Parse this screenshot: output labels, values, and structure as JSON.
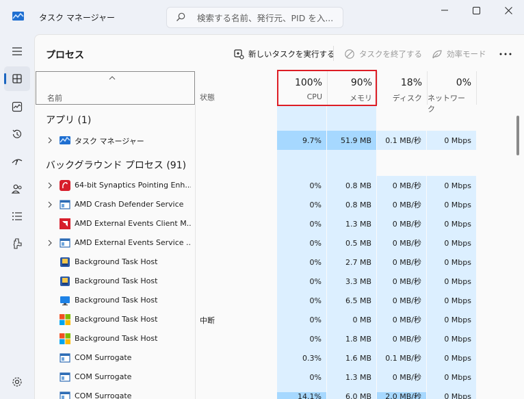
{
  "app": {
    "title": "タスク マネージャー"
  },
  "search": {
    "placeholder": "検索する名前、発行元、PID を入..."
  },
  "toolbar": {
    "page_title": "プロセス",
    "new_task": "新しいタスクを実行する",
    "end_task": "タスクを終了する",
    "efficiency": "効率モード"
  },
  "nav": [
    "hamburger-icon",
    "processes-icon",
    "performance-icon",
    "app-history-icon",
    "startup-apps-icon",
    "users-icon",
    "details-icon",
    "services-icon",
    "settings-icon"
  ],
  "columns": {
    "name": "名前",
    "status": "状態",
    "cpu": {
      "pct": "100%",
      "label": "CPU"
    },
    "memory": {
      "pct": "90%",
      "label": "メモリ"
    },
    "disk": {
      "pct": "18%",
      "label": "ディスク"
    },
    "network": {
      "pct": "0%",
      "label": "ネットワーク"
    }
  },
  "colors": {
    "highlight": "#dd1c24",
    "heat_light": "#dcefff",
    "heat_strong": "#a6d8ff",
    "accent": "#1a65c0"
  },
  "groups": {
    "apps": "アプリ (1)",
    "background": "バックグラウンド プロセス (91)"
  },
  "apps": [
    {
      "name": "タスク マネージャー",
      "status": "",
      "cpu": "9.7%",
      "memory": "51.9 MB",
      "disk": "0.1 MB/秒",
      "network": "0 Mbps",
      "expandable": true,
      "icon": "task-manager-icon"
    }
  ],
  "background": [
    {
      "name": "64-bit Synaptics Pointing Enh...",
      "status": "",
      "cpu": "0%",
      "memory": "0.8 MB",
      "disk": "0 MB/秒",
      "network": "0 Mbps",
      "expandable": true,
      "icon": "synaptics-icon"
    },
    {
      "name": "AMD Crash Defender Service",
      "status": "",
      "cpu": "0%",
      "memory": "0.8 MB",
      "disk": "0 MB/秒",
      "network": "0 Mbps",
      "expandable": true,
      "icon": "service-window-icon"
    },
    {
      "name": "AMD External Events Client M...",
      "status": "",
      "cpu": "0%",
      "memory": "1.3 MB",
      "disk": "0 MB/秒",
      "network": "0 Mbps",
      "expandable": false,
      "icon": "amd-icon"
    },
    {
      "name": "AMD External Events Service ...",
      "status": "",
      "cpu": "0%",
      "memory": "0.5 MB",
      "disk": "0 MB/秒",
      "network": "0 Mbps",
      "expandable": true,
      "icon": "service-window-icon"
    },
    {
      "name": "Background Task Host",
      "status": "",
      "cpu": "0%",
      "memory": "2.7 MB",
      "disk": "0 MB/秒",
      "network": "0 Mbps",
      "expandable": false,
      "icon": "task-host-icon"
    },
    {
      "name": "Background Task Host",
      "status": "",
      "cpu": "0%",
      "memory": "3.3 MB",
      "disk": "0 MB/秒",
      "network": "0 Mbps",
      "expandable": false,
      "icon": "task-host-icon"
    },
    {
      "name": "Background Task Host",
      "status": "",
      "cpu": "0%",
      "memory": "6.5 MB",
      "disk": "0 MB/秒",
      "network": "0 Mbps",
      "expandable": false,
      "icon": "monitor-icon"
    },
    {
      "name": "Background Task Host",
      "status": "中断",
      "cpu": "0%",
      "memory": "0 MB",
      "disk": "0 MB/秒",
      "network": "0 Mbps",
      "expandable": false,
      "icon": "windows-logo-icon"
    },
    {
      "name": "Background Task Host",
      "status": "",
      "cpu": "0%",
      "memory": "1.8 MB",
      "disk": "0 MB/秒",
      "network": "0 Mbps",
      "expandable": false,
      "icon": "windows-logo-icon"
    },
    {
      "name": "COM Surrogate",
      "status": "",
      "cpu": "0.3%",
      "memory": "1.6 MB",
      "disk": "0.1 MB/秒",
      "network": "0 Mbps",
      "expandable": false,
      "icon": "service-window-icon"
    },
    {
      "name": "COM Surrogate",
      "status": "",
      "cpu": "0%",
      "memory": "1.3 MB",
      "disk": "0 MB/秒",
      "network": "0 Mbps",
      "expandable": false,
      "icon": "service-window-icon"
    },
    {
      "name": "COM Surrogate",
      "status": "",
      "cpu": "14.1%",
      "memory": "6.0 MB",
      "disk": "2.0 MB/秒",
      "network": "0 Mbps",
      "expandable": false,
      "icon": "service-window-icon"
    }
  ]
}
